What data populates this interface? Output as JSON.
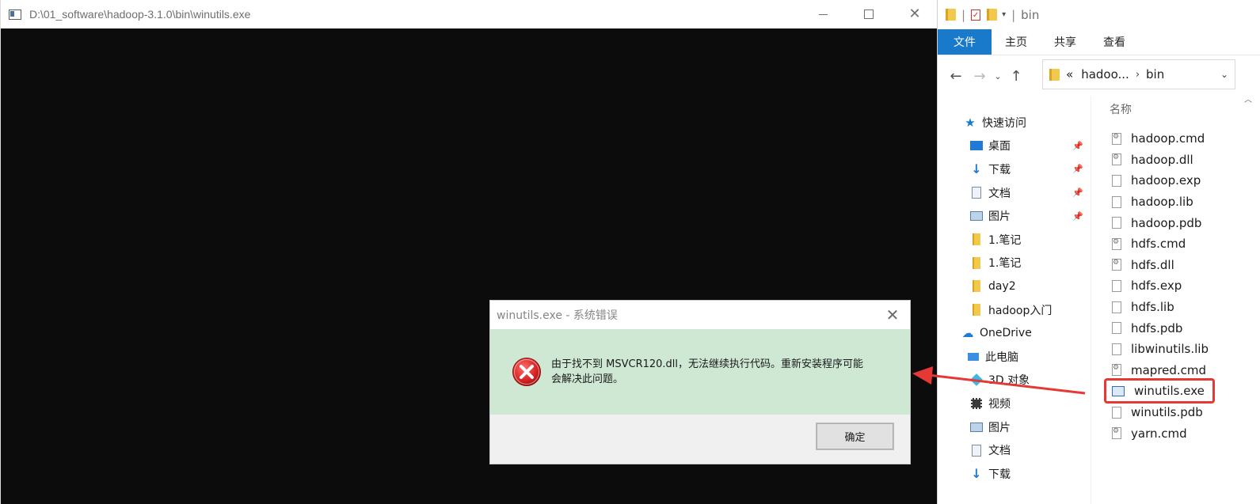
{
  "console": {
    "title": "D:\\01_software\\hadoop-3.1.0\\bin\\winutils.exe"
  },
  "dialog": {
    "title": "winutils.exe - 系统错误",
    "message_line1": "由于找不到 MSVCR120.dll，无法继续执行代码。重新安装程序可能",
    "message_line2": "会解决此问题。",
    "ok_label": "确定",
    "close_glyph": "✕"
  },
  "explorer": {
    "title": "bin",
    "ribbon_tabs": [
      "文件",
      "主页",
      "共享",
      "查看"
    ],
    "address": {
      "prefix": "«",
      "segments": [
        "hadoo...",
        "bin"
      ]
    },
    "column_header": "名称",
    "nav_items": [
      {
        "label": "快速访问",
        "icon": "star-icon",
        "pinned": false
      },
      {
        "label": "桌面",
        "icon": "desktop-icon",
        "pinned": true
      },
      {
        "label": "下载",
        "icon": "download-icon",
        "pinned": true
      },
      {
        "label": "文档",
        "icon": "document-icon",
        "pinned": true
      },
      {
        "label": "图片",
        "icon": "pictures-icon",
        "pinned": true
      },
      {
        "label": "1.笔记",
        "icon": "folder-icon",
        "pinned": false
      },
      {
        "label": "1.笔记",
        "icon": "folder-icon",
        "pinned": false
      },
      {
        "label": "day2",
        "icon": "folder-icon",
        "pinned": false
      },
      {
        "label": "hadoop入门",
        "icon": "folder-icon",
        "pinned": false
      },
      {
        "label": "OneDrive",
        "icon": "cloud-icon",
        "pinned": false
      },
      {
        "label": "此电脑",
        "icon": "pc-icon",
        "pinned": false
      },
      {
        "label": "3D 对象",
        "icon": "3d-objects-icon",
        "pinned": false
      },
      {
        "label": "视频",
        "icon": "video-icon",
        "pinned": false
      },
      {
        "label": "图片",
        "icon": "pictures-icon",
        "pinned": false
      },
      {
        "label": "文档",
        "icon": "document-icon",
        "pinned": false
      },
      {
        "label": "下载",
        "icon": "download-icon",
        "pinned": false
      }
    ],
    "files": [
      {
        "name": "hadoop.cmd",
        "icon": "gear-file-icon"
      },
      {
        "name": "hadoop.dll",
        "icon": "gear-file-icon"
      },
      {
        "name": "hadoop.exp",
        "icon": "blank-file-icon"
      },
      {
        "name": "hadoop.lib",
        "icon": "blank-file-icon"
      },
      {
        "name": "hadoop.pdb",
        "icon": "blank-file-icon"
      },
      {
        "name": "hdfs.cmd",
        "icon": "gear-file-icon"
      },
      {
        "name": "hdfs.dll",
        "icon": "gear-file-icon"
      },
      {
        "name": "hdfs.exp",
        "icon": "blank-file-icon"
      },
      {
        "name": "hdfs.lib",
        "icon": "blank-file-icon"
      },
      {
        "name": "hdfs.pdb",
        "icon": "blank-file-icon"
      },
      {
        "name": "libwinutils.lib",
        "icon": "blank-file-icon"
      },
      {
        "name": "mapred.cmd",
        "icon": "gear-file-icon"
      },
      {
        "name": "winutils.exe",
        "icon": "exe-file-icon",
        "highlighted": true
      },
      {
        "name": "winutils.pdb",
        "icon": "blank-file-icon"
      },
      {
        "name": "yarn.cmd",
        "icon": "gear-file-icon"
      }
    ]
  },
  "colors": {
    "accent": "#1979ca",
    "dialog_body": "#cfe8d4",
    "annotation_red": "#e53935",
    "console_bg": "#0c0c0c"
  }
}
